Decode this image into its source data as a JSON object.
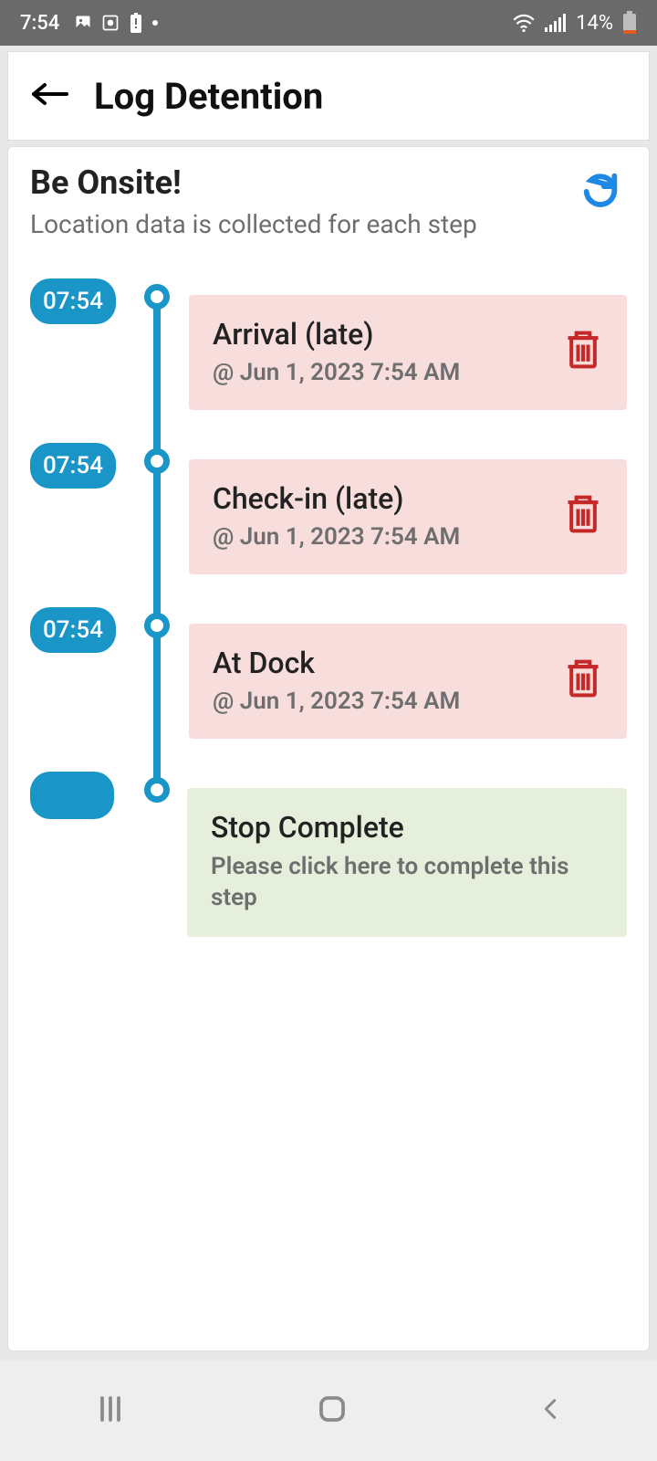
{
  "status": {
    "time": "7:54",
    "battery": "14%"
  },
  "header": {
    "title": "Log Detention"
  },
  "card": {
    "title": "Be Onsite!",
    "subtitle": "Location data is collected for each step"
  },
  "steps": [
    {
      "time": "07:54",
      "title": "Arrival (late)",
      "sub": "@ Jun 1, 2023 7:54 AM",
      "deletable": true,
      "variant": "pink"
    },
    {
      "time": "07:54",
      "title": "Check-in (late)",
      "sub": "@ Jun 1, 2023 7:54 AM",
      "deletable": true,
      "variant": "pink"
    },
    {
      "time": "07:54",
      "title": "At Dock",
      "sub": "@ Jun 1, 2023 7:54 AM",
      "deletable": true,
      "variant": "pink"
    },
    {
      "time": "",
      "title": "Stop Complete",
      "prompt": "Please click here to complete this step",
      "deletable": false,
      "variant": "green"
    }
  ]
}
